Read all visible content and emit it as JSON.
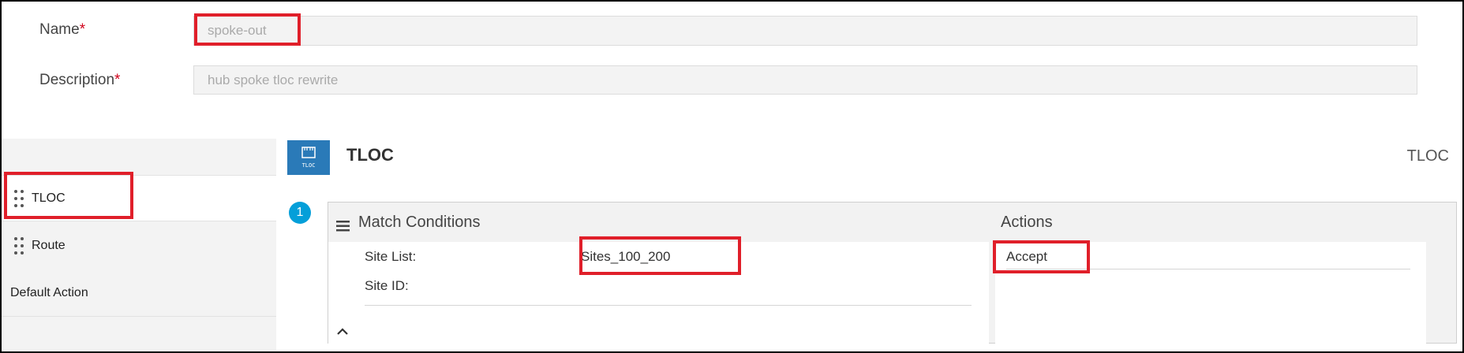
{
  "form": {
    "name_label": "Name",
    "name_required": "*",
    "name_value": "spoke-out",
    "description_label": "Description",
    "description_required": "*",
    "description_value": "hub spoke tloc rewrite"
  },
  "sidebar": {
    "items": [
      {
        "label": "TLOC",
        "active": true
      },
      {
        "label": "Route",
        "active": false
      },
      {
        "label": "Default Action",
        "active": false
      }
    ]
  },
  "header": {
    "icon_text": "TLOC",
    "title": "TLOC",
    "type_label": "TLOC"
  },
  "sequence": {
    "number": "1",
    "match_title": "Match Conditions",
    "actions_title": "Actions",
    "match_rows": [
      {
        "label": "Site List:",
        "value": "Sites_100_200"
      },
      {
        "label": "Site ID:",
        "value": ""
      }
    ],
    "action_value": "Accept"
  },
  "colors": {
    "highlight": "#e01f2a",
    "accent_blue": "#049fd9",
    "tile_blue": "#2a7ab8",
    "required": "#d0021b"
  }
}
